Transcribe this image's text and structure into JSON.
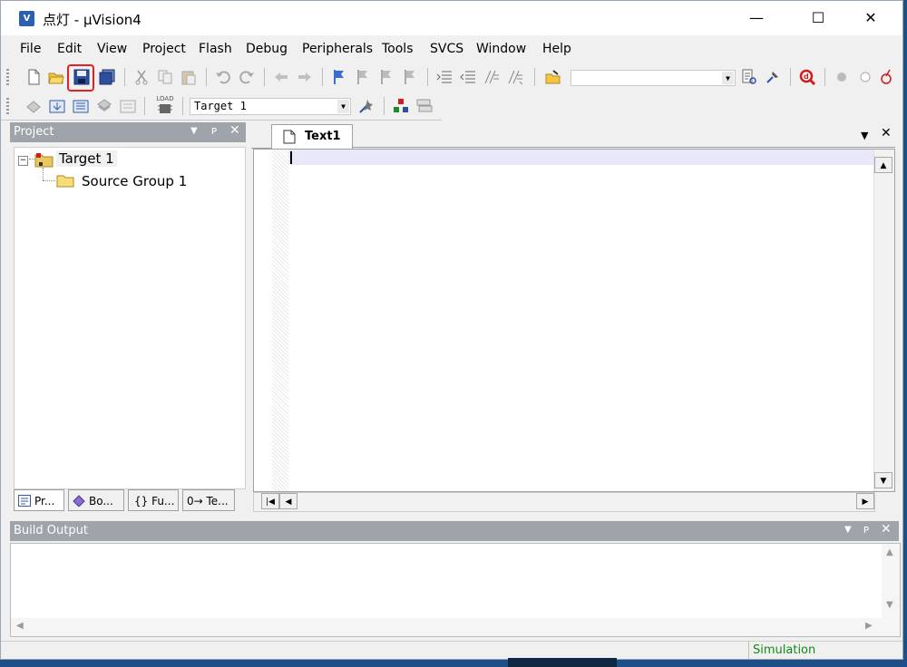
{
  "window": {
    "title": "点灯  - μVision4",
    "icon_label": "V"
  },
  "controls": {
    "minimize": "—",
    "maximize": "☐",
    "close": "✕"
  },
  "menu": [
    {
      "label": "File"
    },
    {
      "label": "Edit"
    },
    {
      "label": "View"
    },
    {
      "label": "Project"
    },
    {
      "label": "Flash"
    },
    {
      "label": "Debug"
    },
    {
      "label": "Peripherals"
    },
    {
      "label": "Tools"
    },
    {
      "label": "SVCS"
    },
    {
      "label": "Window"
    },
    {
      "label": "Help"
    }
  ],
  "toolbar2": {
    "target_select": "Target 1",
    "load_label": "LOAD"
  },
  "project_panel": {
    "title": "Project",
    "tree_root": "Target 1",
    "tree_child": "Source Group 1",
    "tabs": [
      "Pr...",
      "Bo...",
      "{} Fu...",
      "0→ Te..."
    ]
  },
  "editor": {
    "tab": "Text1"
  },
  "build_output": {
    "title": "Build Output"
  },
  "status": {
    "mode": "Simulation"
  },
  "colors": {
    "highlight": "#e52020",
    "panel_header": "#9fa3aa",
    "status_text": "#148a14"
  }
}
